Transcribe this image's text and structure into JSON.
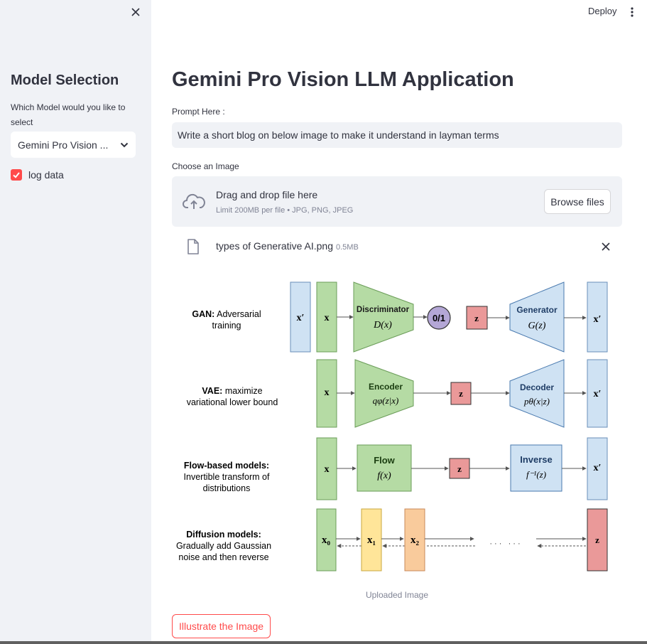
{
  "sidebar": {
    "title": "Model Selection",
    "question": "Which Model would you like to select",
    "selected_model": "Gemini Pro Vision ...",
    "checkbox_label": "log data",
    "checkbox_checked": true
  },
  "header": {
    "deploy_label": "Deploy"
  },
  "main": {
    "title": "Gemini Pro Vision LLM Application",
    "prompt_label": "Prompt Here :",
    "prompt_value": "Write a short blog on below image to make it understand in layman terms",
    "image_label": "Choose an Image",
    "uploader": {
      "drag_text": "Drag and drop file here",
      "limit_text": "Limit 200MB per file • JPG, PNG, JPEG",
      "browse_label": "Browse files"
    },
    "file": {
      "name": "types of Generative AI.png",
      "size": "0.5MB"
    },
    "image_caption": "Uploaded Image",
    "action_button": "Illustrate the Image"
  },
  "diagram": {
    "gan_title": "GAN:",
    "gan_desc1": "Adversarial",
    "gan_desc2": "training",
    "vae_title": "VAE:",
    "vae_desc1": "maximize",
    "vae_desc2": "variational lower bound",
    "flow_title": "Flow-based models:",
    "flow_desc1": "Invertible transform of",
    "flow_desc2": "distributions",
    "diff_title": "Diffusion models:",
    "diff_desc1": "Gradually add Gaussian",
    "diff_desc2": "noise and then reverse",
    "x": "x",
    "x_prime": "x′",
    "z": "z",
    "discriminator": "Discriminator",
    "discriminator_fn": "D(x)",
    "binary": "0/1",
    "generator": "Generator",
    "generator_fn": "G(z)",
    "encoder": "Encoder",
    "encoder_fn": "qφ(z|x)",
    "decoder": "Decoder",
    "decoder_fn": "pθ(x|z)",
    "flow": "Flow",
    "flow_fn": "f(x)",
    "inverse": "Inverse",
    "inverse_fn": "f⁻¹(z)",
    "x0": "x₀",
    "x1": "x₁",
    "x2": "x₂",
    "dots": "· · ·   · · ·",
    "colors": {
      "green": "#b5dba4",
      "blue": "#cfe2f3",
      "red": "#ea9999",
      "yellow": "#ffe599",
      "orange": "#f9cb9c",
      "purple": "#b4a7d6"
    }
  }
}
